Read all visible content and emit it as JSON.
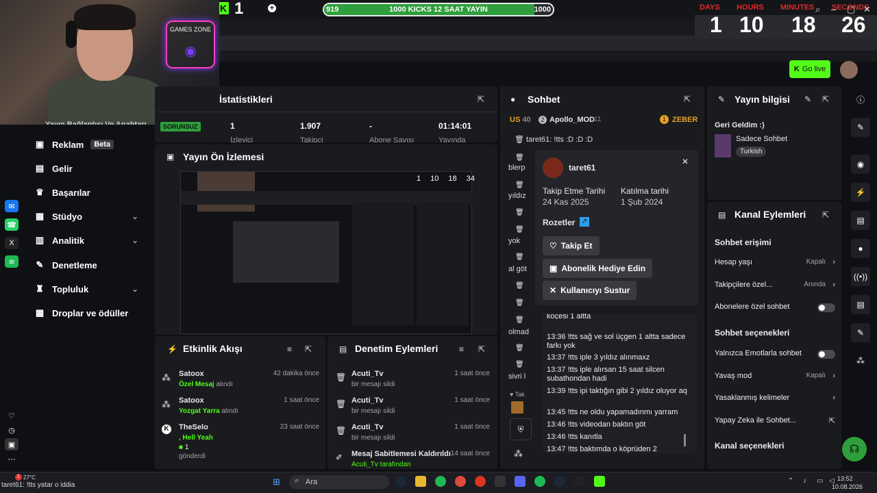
{
  "overlay": {
    "kick_count": "1",
    "progress": {
      "left": "919",
      "title": "1000 KICKS 12 SAAT YAYIN",
      "right": "1000",
      "fraction": 0.919
    },
    "countdown": [
      {
        "label": "DAYS",
        "value": "1"
      },
      {
        "label": "HOURS",
        "value": "10"
      },
      {
        "label": "MINUTES",
        "value": "18"
      },
      {
        "label": "SECONDS",
        "value": "26"
      }
    ],
    "webcam_sign": "GAMES ZONE"
  },
  "header": {
    "go_live": "Go live"
  },
  "sidebar": {
    "cut_item": "Yayın Bağlantısı Ve Anahtarı",
    "items": [
      {
        "label": "Reklam",
        "badge": "Beta",
        "icon": "megaphone-icon"
      },
      {
        "label": "Gelir",
        "icon": "revenue-icon"
      },
      {
        "label": "Başarılar",
        "icon": "trophy-icon"
      },
      {
        "label": "Stüdyo",
        "icon": "studio-icon",
        "expand": true
      },
      {
        "label": "Analitik",
        "icon": "chart-icon",
        "expand": true
      },
      {
        "label": "Denetleme",
        "icon": "wrench-icon"
      },
      {
        "label": "Topluluk",
        "icon": "community-icon",
        "expand": true
      },
      {
        "label": "Droplar ve ödüller",
        "icon": "gift-icon"
      }
    ]
  },
  "stats": {
    "title": "İstatistikleri",
    "status": "SORUNSUZ",
    "items": [
      {
        "value": "1",
        "label": "İzleyici"
      },
      {
        "value": "1.907",
        "label": "Takipçi"
      },
      {
        "value": "-",
        "label": "Abone Sayısı"
      },
      {
        "value": "01:14:01",
        "label": "Yayında"
      }
    ]
  },
  "preview": {
    "title": "Yayın Ön İzlemesi",
    "mini_counts": [
      "1",
      "10",
      "18",
      "34"
    ]
  },
  "activity": {
    "title": "Etkinlik Akışı",
    "items": [
      {
        "user": "Satoox",
        "action": "Özel Mesaj",
        "suffix": "alındı",
        "time": "42 dakika önce"
      },
      {
        "user": "Satoox",
        "action": "Yozgat Yarra",
        "suffix": "alındı",
        "time": "1 saat önce"
      },
      {
        "user": "TheSelo",
        "action": ", Hell Yeah",
        "amount": "1",
        "suffix": "gönderdi",
        "time": "23 saat önce"
      }
    ]
  },
  "modlog": {
    "title": "Denetim Eylemleri",
    "items": [
      {
        "user": "Acuti_Tv",
        "action": "bir mesajı sildi",
        "time": "1 saat önce"
      },
      {
        "user": "Acuti_Tv",
        "action": "bir mesajı sildi",
        "time": "1 saat önce"
      },
      {
        "user": "Acuti_Tv",
        "action": "bir mesajı sildi",
        "time": "1 saat önce"
      },
      {
        "user": "Mesaj Sabitlemesi Kaldırıldı",
        "action": "Acuti_Tv tarafından",
        "time": "14 saat önce"
      }
    ]
  },
  "chat": {
    "title": "Sohbet",
    "top": {
      "rank": "US",
      "rank_num": "40",
      "user": "Apollo_MOD",
      "num": "11",
      "right": "ZEBER"
    },
    "first_msg": "taret61: !tts :D :D :D",
    "fragments": [
      "blerp",
      "yıldız",
      "yok",
      "al göt",
      "olmad",
      "sivri l"
    ],
    "tak": "Tak"
  },
  "popup": {
    "username": "taret61",
    "follow_label": "Takip Etme Tarihi",
    "follow_date": "24 Kas 2025",
    "join_label": "Katılma tarihi",
    "join_date": "1 Şub 2024",
    "badges_label": "Rozetler",
    "buttons": [
      "Takip Et",
      "Abonelik Hediye Edin",
      "Kullanıcıyı Sustur"
    ],
    "history": [
      "koçesi 1 altta",
      "13:36 !tts sağ ve sol üçgen 1 altta sadece farkı yok",
      "13:37 !tts iple 3 yıldız alınmaxz",
      "13:37 !tts iple alırsan 15 saat silcen subathondan hadi",
      "13:39 !tts ipi taktığın gibi 2 yıldız oluyor aq",
      "13:45 !tts ne oldu yapamadınmı yarram",
      "13:46 !tts videodan baktın göt",
      "13:46 !tts kanıtla",
      "13:47 !tts baktımda o köprüden 2"
    ]
  },
  "info": {
    "title": "Yayın bilgisi",
    "stream_title": "Geri Geldim :)",
    "category": "Sadece Sohbet",
    "tag": "Turkish"
  },
  "channel": {
    "title": "Kanal Eylemleri",
    "chat_access": "Sohbet erişimi",
    "account_age": "Hesap yaşı",
    "account_age_val": "Kapalı",
    "followers": "Takipçilere özel...",
    "followers_val": "Anında",
    "subs": "Abonelere özel sohbet",
    "chat_options": "Sohbet seçenekleri",
    "emote_only": "Yalnızca Emotlarla sohbet",
    "slow_mode": "Yavaş mod",
    "slow_val": "Kapalı",
    "banned_words": "Yasaklanmış kelimeler",
    "ai": "Yapay Zeka ile Sohbet...",
    "channel_options": "Kanal seçenekleri"
  },
  "taskbar": {
    "weather": "27°C",
    "ticker": "taret61: !tts yatar o iddia",
    "search": "Ara",
    "time": "13:52",
    "date": "10.08.2026"
  }
}
